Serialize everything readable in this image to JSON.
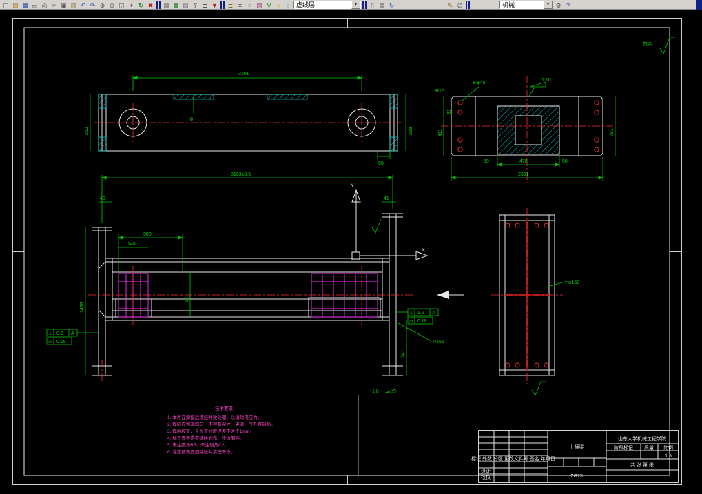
{
  "toolbar": {
    "arrow": "▾",
    "layer_combo": "虚线层",
    "style_combo": "机械",
    "icons": [
      {
        "n": "new",
        "g": "▢"
      },
      {
        "n": "open",
        "g": "▤"
      },
      {
        "n": "save",
        "g": "▦"
      },
      {
        "n": "print",
        "g": "▭"
      },
      {
        "n": "preview",
        "g": "◎"
      },
      {
        "n": "cut",
        "g": "✂"
      },
      {
        "n": "copy",
        "g": "▣"
      },
      {
        "n": "paste",
        "g": "▥"
      },
      {
        "n": "undo",
        "g": "↶"
      },
      {
        "n": "redo",
        "g": "↷"
      },
      {
        "n": "zoom-in",
        "g": "⊕"
      },
      {
        "n": "zoom-out",
        "g": "⊖"
      },
      {
        "n": "zoom-window",
        "g": "◱"
      },
      {
        "n": "pan",
        "g": "+"
      },
      {
        "n": "redraw",
        "g": "↻"
      },
      {
        "n": "erase",
        "g": "✖"
      },
      {
        "n": "grid",
        "g": "▦"
      },
      {
        "n": "table",
        "g": "▦"
      },
      {
        "n": "sheet",
        "g": "▤"
      },
      {
        "n": "formula",
        "g": "∑"
      },
      {
        "n": "sort",
        "g": "≣"
      },
      {
        "n": "filter",
        "g": "▼"
      },
      {
        "n": "layers",
        "g": "≣"
      },
      {
        "n": "linetype",
        "g": "≡"
      },
      {
        "n": "lineweight",
        "g": "≡"
      },
      {
        "n": "color",
        "g": "▧"
      },
      {
        "n": "check",
        "g": "V"
      },
      {
        "n": "circle-yellow",
        "g": "○"
      },
      {
        "n": "circle-cyan",
        "g": "○"
      },
      {
        "n": "match",
        "g": "▯"
      },
      {
        "n": "properties",
        "g": "▤"
      },
      {
        "n": "refresh",
        "g": "↻"
      },
      {
        "n": "pencil",
        "g": "✎"
      },
      {
        "n": "measure",
        "g": "∅"
      },
      {
        "n": "gear",
        "g": "⚙"
      },
      {
        "n": "help",
        "g": "?"
      }
    ]
  },
  "drawing": {
    "surface_note": "其余",
    "top_view": {
      "length": "3101",
      "height_left": "262",
      "height_right": "218",
      "offset": "50",
      "position_mark": "⊕"
    },
    "section_view": {
      "holes": "8-φ45",
      "slope": "1:10",
      "width": "2301",
      "inner": "470",
      "edge_left": "50",
      "edge_right": "50",
      "height": "411",
      "top_edge": "91",
      "radius": "R16",
      "side": "781"
    },
    "front_view": {
      "length": "3103±0.5",
      "left_gap": "40",
      "right_gap": "41",
      "d300": "300",
      "d140": "140",
      "d65": "65",
      "d341": "341",
      "d2438": "2438",
      "radius": "R165",
      "slope": "1:8",
      "axis_x": "X",
      "axis_y": "Y",
      "tol1_sym": "⊥",
      "tol1_val": "0.2",
      "tol1_datum": "A",
      "tol2_sym": "▱",
      "tol2_val": "0.18",
      "tol3_sym": "⊥",
      "tol3_val": "1.2",
      "tol3_datum": "A",
      "tol4_sym": "▱",
      "tol4_val": "0.18"
    },
    "side_view": {
      "dia": "φ150"
    },
    "tech_req": {
      "title": "技术要求",
      "item1": "1. 本件在焊接后须经时效处理，以消除内应力。",
      "item2": "2. 焊缝应饱满均匀，不得有裂纹、夹渣、气孔等缺陷。",
      "item3": "3. 焊后校直，全长直线度误差不大于1mm。",
      "item4": "4. 加工面不得有磕碰划伤，锐边倒钝。",
      "item5": "5. 未注圆角R5，未注倒角C2。",
      "item6": "6. 涂漆前表面须除锈并清理干净。"
    },
    "title_block": {
      "part_name": "上横梁",
      "material": "ZG25",
      "company": "山东大学机械工程学院",
      "scale": "1:5",
      "scale_label": "比例",
      "stage_label": "阶段标记",
      "mass_label": "质量",
      "sheets": "共 张 第 张",
      "design": "设计",
      "check": "校核",
      "header": "标记 处数 分区 更改文件号 签名 年月日"
    }
  }
}
